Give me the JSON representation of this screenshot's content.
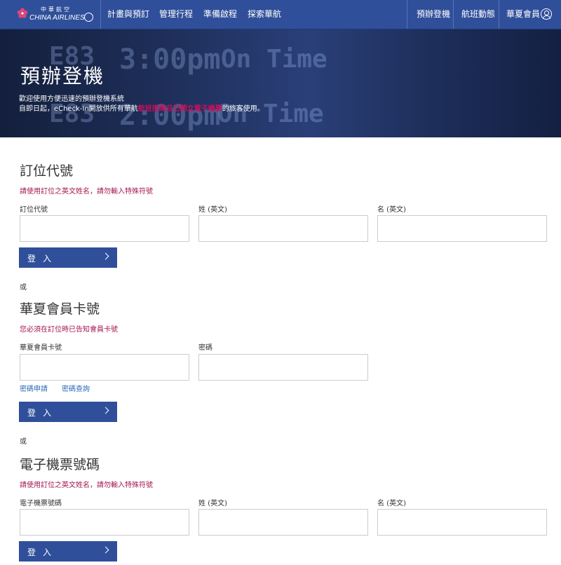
{
  "brand": {
    "logo_cn": "中華航空",
    "logo_en": "CHINA AIRLINES"
  },
  "nav": {
    "left": [
      "計畫與預訂",
      "管理行程",
      "準備啟程",
      "探索華航"
    ],
    "right": [
      "預辦登機",
      "航班動態",
      "華夏會員"
    ]
  },
  "hero": {
    "title": "預辦登機",
    "intro_line1": "歡迎使用方便迅速的預辦登機系統",
    "intro_line2_pre": "自即日起，eCheck-In開放供所有華航",
    "intro_line2_highlight": "航班搭乘且已開立電子機票",
    "intro_line2_post": "的旅客使用。",
    "board": [
      "E83",
      "3:00pm",
      "On Time",
      "E83",
      "2:00pm",
      "On Time"
    ]
  },
  "sections": [
    {
      "title": "訂位代號",
      "note": "請使用訂位之英文姓名，請勿輸入特殊符號",
      "fields": [
        {
          "label": "訂位代號",
          "value": ""
        },
        {
          "label": "姓 (英文)",
          "value": ""
        },
        {
          "label": "名 (英文)",
          "value": ""
        }
      ],
      "button": "登入"
    },
    {
      "title": "華夏會員卡號",
      "note": "您必須在訂位時已告知會員卡號",
      "fields": [
        {
          "label": "華夏會員卡號",
          "value": ""
        },
        {
          "label": "密碼",
          "value": ""
        }
      ],
      "links": [
        "密碼申請",
        "密碼查詢"
      ],
      "button": "登入"
    },
    {
      "title": "電子機票號碼",
      "note": "請使用訂位之英文姓名，請勿輸入特殊符號",
      "fields": [
        {
          "label": "電子機票號碼",
          "value": ""
        },
        {
          "label": "姓 (英文)",
          "value": ""
        },
        {
          "label": "名 (英文)",
          "value": ""
        }
      ],
      "button": "登入"
    }
  ],
  "or_label": "或",
  "colors": {
    "nav": "#2f4f9a",
    "button": "#2f4f9a",
    "note": "#a3164f",
    "highlight": "#c8105a",
    "link": "#2f6bb5"
  }
}
